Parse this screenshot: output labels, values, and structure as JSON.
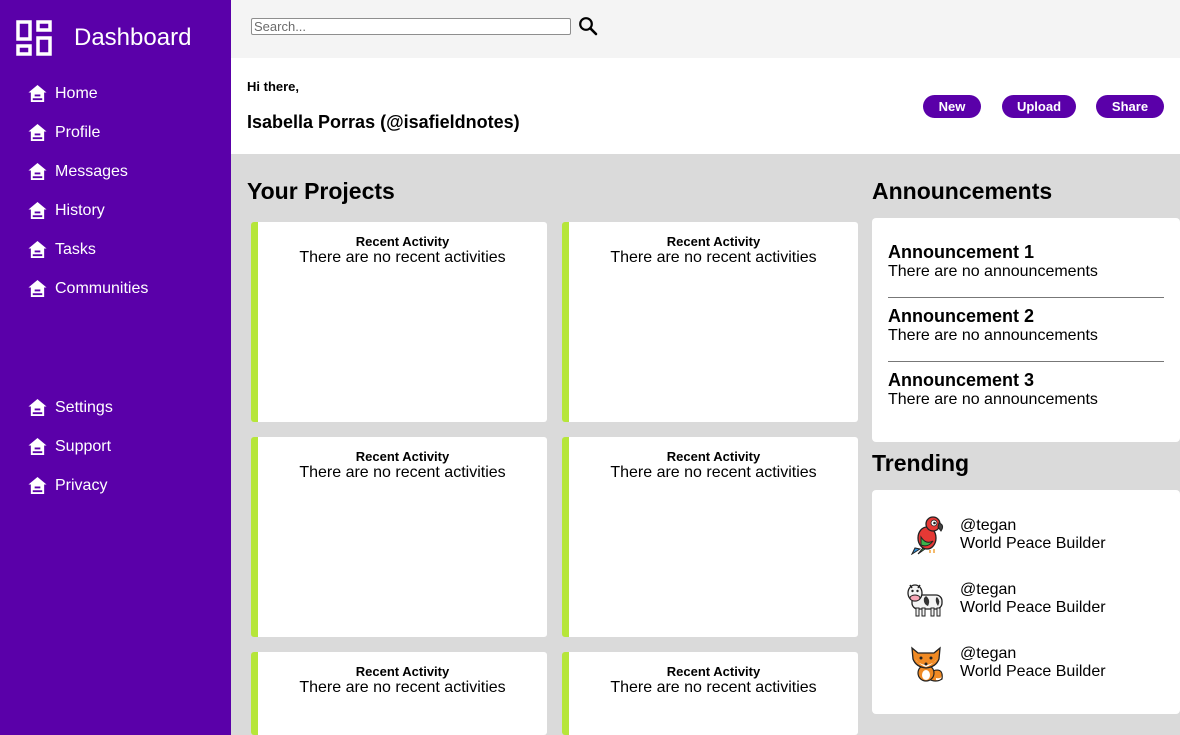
{
  "sidebar": {
    "title": "Dashboard",
    "logo_icon": "dashboard-grid-icon",
    "nav_icon": "home-icon",
    "main_items": [
      {
        "label": "Home"
      },
      {
        "label": "Profile"
      },
      {
        "label": "Messages"
      },
      {
        "label": "History"
      },
      {
        "label": "Tasks"
      },
      {
        "label": "Communities"
      }
    ],
    "bottom_items": [
      {
        "label": "Settings"
      },
      {
        "label": "Support"
      },
      {
        "label": "Privacy"
      }
    ]
  },
  "search": {
    "placeholder": "Search...",
    "value": "",
    "icon": "search-icon"
  },
  "header": {
    "greeting": "Hi there,",
    "user": "Isabella Porras (@isafieldnotes)",
    "buttons": {
      "new": "New",
      "upload": "Upload",
      "share": "Share"
    }
  },
  "projects": {
    "title": "Your Projects",
    "cards": [
      {
        "title": "Recent Activity",
        "text": "There are no recent activities"
      },
      {
        "title": "Recent Activity",
        "text": "There are no recent activities"
      },
      {
        "title": "Recent Activity",
        "text": "There are no recent activities"
      },
      {
        "title": "Recent Activity",
        "text": "There are no recent activities"
      },
      {
        "title": "Recent Activity",
        "text": "There are no recent activities"
      },
      {
        "title": "Recent Activity",
        "text": "There are no recent activities"
      }
    ]
  },
  "announcements": {
    "title": "Announcements",
    "items": [
      {
        "heading": "Announcement 1",
        "text": "There are no announcements"
      },
      {
        "heading": "Announcement 2",
        "text": "There are no announcements"
      },
      {
        "heading": "Announcement 3",
        "text": "There are no announcements"
      }
    ]
  },
  "trending": {
    "title": "Trending",
    "items": [
      {
        "avatar": "parrot-icon",
        "handle": "@tegan",
        "tagline": "World Peace Builder"
      },
      {
        "avatar": "cow-icon",
        "handle": "@tegan",
        "tagline": "World Peace Builder"
      },
      {
        "avatar": "fox-icon",
        "handle": "@tegan",
        "tagline": "World Peace Builder"
      }
    ]
  },
  "colors": {
    "sidebar": "#5a00a9",
    "button": "#5a00a9",
    "card_accent": "#b6e63a",
    "background": "#dadada"
  }
}
